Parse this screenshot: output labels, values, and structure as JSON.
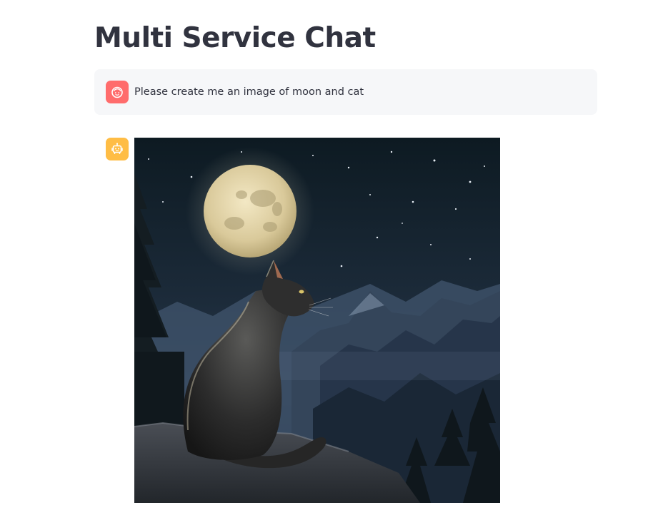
{
  "app": {
    "title": "Multi Service Chat"
  },
  "messages": [
    {
      "role": "user",
      "avatar_icon": "user-face-icon",
      "text": "Please create me an image of moon and cat"
    },
    {
      "role": "assistant",
      "avatar_icon": "robot-icon",
      "content_type": "image"
    }
  ],
  "colors": {
    "user_avatar": "#ff6c6c",
    "assistant_avatar": "#ffbd45",
    "user_message_bg": "#f6f7f9",
    "title_text": "#31333f"
  }
}
